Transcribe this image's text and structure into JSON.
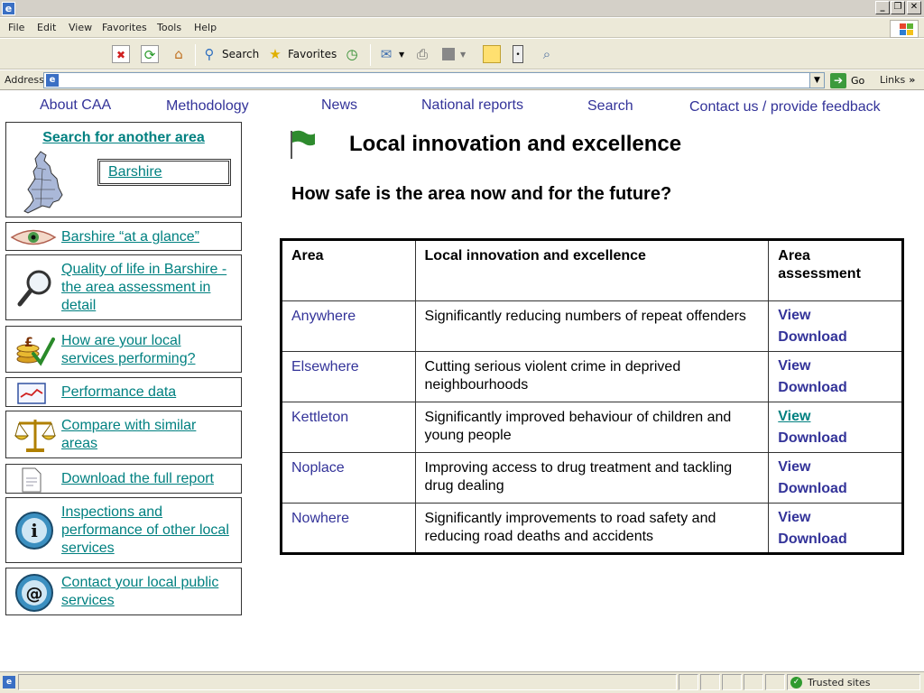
{
  "browser": {
    "title_text": "",
    "menu": [
      "File",
      "Edit",
      "View",
      "Favorites",
      "Tools",
      "Help"
    ],
    "toolbar": {
      "search_label": "Search",
      "favorites_label": "Favorites"
    },
    "address": {
      "label": "Address",
      "value": ""
    },
    "go_label": "Go",
    "links_label": "Links",
    "status": {
      "zone_label": "Trusted sites"
    }
  },
  "nav": {
    "about": "About CAA",
    "methodology": "Methodology",
    "news": "News",
    "national_reports": "National reports",
    "search": "Search",
    "contact": "Contact us / provide feedback"
  },
  "sidebar": {
    "search_title": "Search for another area",
    "area_value": "Barshire",
    "items": [
      {
        "label": "Barshire “at a glance”",
        "icon": "eye-icon"
      },
      {
        "label": "Quality of life in Barshire - the area assessment in detail",
        "icon": "magnifier-icon"
      },
      {
        "label": "How are your local services performing?",
        "icon": "money-check-icon"
      },
      {
        "label": "Performance data",
        "icon": "line-chart-icon"
      },
      {
        "label": "Compare with similar areas",
        "icon": "scales-icon"
      },
      {
        "label": "Download the full report",
        "icon": "document-icon"
      },
      {
        "label": "Inspections and performance of other local services",
        "icon": "info-globe-icon"
      },
      {
        "label": "Contact your local public services",
        "icon": "email-globe-icon"
      }
    ]
  },
  "main": {
    "title": "Local innovation and excellence",
    "subtitle": "How safe is the area now and for the future?",
    "table": {
      "headers": [
        "Area",
        "Local innovation and excellence",
        "Area assessment"
      ],
      "rows": [
        {
          "area": "Anywhere",
          "text": "Significantly reducing numbers of repeat offenders",
          "view": "View",
          "download": "Download"
        },
        {
          "area": "Elsewhere",
          "text": "Cutting serious violent crime in deprived neighbourhoods",
          "view": "View",
          "download": "Download"
        },
        {
          "area": "Kettleton",
          "text": "Significantly improved behaviour of children and young people",
          "view": "View",
          "download": "Download"
        },
        {
          "area": "Noplace",
          "text": "Improving access to drug treatment and tackling drug dealing",
          "view": "View",
          "download": "Download"
        },
        {
          "area": "Nowhere",
          "text": "Significantly improvements to road safety and reducing road deaths and accidents",
          "view": "View",
          "download": "Download"
        }
      ]
    }
  },
  "colors": {
    "nav_link": "#333399",
    "side_link": "#008080",
    "flag": "#2e8b2e"
  }
}
